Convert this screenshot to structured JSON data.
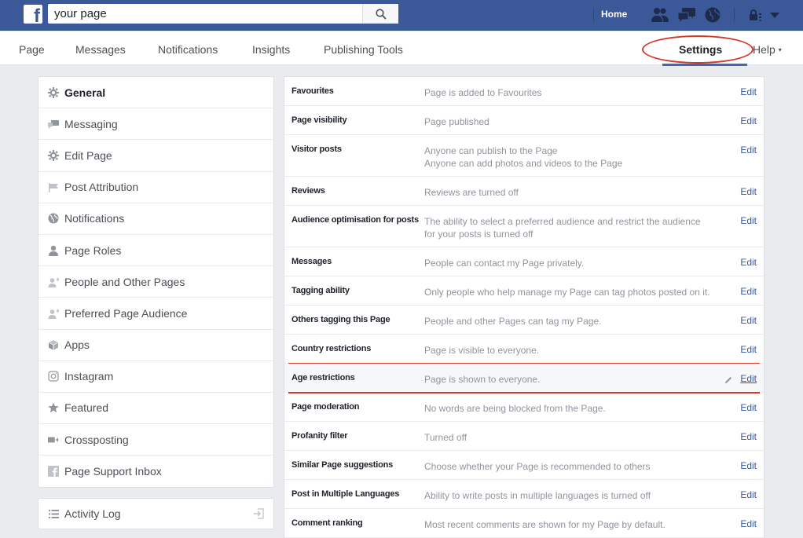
{
  "topbar": {
    "search_value": "your page",
    "search_placeholder": "Search",
    "home_label": "Home",
    "icons": [
      "facebook-logo-icon",
      "search-icon",
      "friend-requests-icon",
      "messages-icon",
      "notifications-globe-icon",
      "privacy-shortcuts-icon",
      "account-dropdown-icon"
    ]
  },
  "nav": {
    "tabs": [
      {
        "label": "Page"
      },
      {
        "label": "Messages"
      },
      {
        "label": "Notifications"
      },
      {
        "label": "Insights"
      },
      {
        "label": "Publishing Tools"
      }
    ],
    "settings_label": "Settings",
    "help_label": "Help",
    "help_caret": "▾"
  },
  "sidebar": {
    "items": [
      {
        "label": "General",
        "icon": "gear-icon",
        "active": true
      },
      {
        "label": "Messaging",
        "icon": "chat-bubbles-icon"
      },
      {
        "label": "Edit Page",
        "icon": "gear-icon"
      },
      {
        "label": "Post Attribution",
        "icon": "flag-icon"
      },
      {
        "label": "Notifications",
        "icon": "globe-icon"
      },
      {
        "label": "Page Roles",
        "icon": "person-icon"
      },
      {
        "label": "People and Other Pages",
        "icon": "person-star-icon"
      },
      {
        "label": "Preferred Page Audience",
        "icon": "person-star-icon"
      },
      {
        "label": "Apps",
        "icon": "cube-icon"
      },
      {
        "label": "Instagram",
        "icon": "instagram-icon"
      },
      {
        "label": "Featured",
        "icon": "star-icon"
      },
      {
        "label": "Crossposting",
        "icon": "video-camera-icon"
      },
      {
        "label": "Page Support Inbox",
        "icon": "facebook-square-icon"
      }
    ],
    "activity_log": {
      "label": "Activity Log",
      "icon": "list-icon",
      "action_icon": "exit-arrow-icon"
    }
  },
  "settings": {
    "edit_label": "Edit",
    "rows": [
      {
        "name": "Favourites",
        "desc": [
          "Page is added to Favourites"
        ]
      },
      {
        "name": "Page visibility",
        "desc": [
          "Page published"
        ]
      },
      {
        "name": "Visitor posts",
        "desc": [
          "Anyone can publish to the Page",
          "Anyone can add photos and videos to the Page"
        ]
      },
      {
        "name": "Reviews",
        "desc": [
          "Reviews are turned off"
        ]
      },
      {
        "name": "Audience optimisation for posts",
        "desc": [
          "The ability to select a preferred audience and restrict the audience",
          "for your posts is turned off"
        ]
      },
      {
        "name": "Messages",
        "desc": [
          "People can contact my Page privately."
        ]
      },
      {
        "name": "Tagging ability",
        "desc": [
          "Only people who help manage my Page can tag photos posted on it."
        ]
      },
      {
        "name": "Others tagging this Page",
        "desc": [
          "People and other Pages can tag my Page."
        ]
      },
      {
        "name": "Country restrictions",
        "desc": [
          "Page is visible to everyone."
        ],
        "annotated": true
      },
      {
        "name": "Age restrictions",
        "desc": [
          "Page is shown to everyone."
        ],
        "annotated": true,
        "hovered": true
      },
      {
        "name": "Page moderation",
        "desc": [
          "No words are being blocked from the Page."
        ]
      },
      {
        "name": "Profanity filter",
        "desc": [
          "Turned off"
        ]
      },
      {
        "name": "Similar Page suggestions",
        "desc": [
          "Choose whether your Page is recommended to others"
        ]
      },
      {
        "name": "Post in Multiple Languages",
        "desc": [
          "Ability to write posts in multiple languages is turned off"
        ]
      },
      {
        "name": "Comment ranking",
        "desc": [
          "Most recent comments are shown for my Page by default."
        ]
      }
    ]
  },
  "colors": {
    "brand_blue": "#3b5998",
    "link_blue": "#365899",
    "annotation_red": "#d33a2c",
    "muted_text": "#90949c"
  }
}
